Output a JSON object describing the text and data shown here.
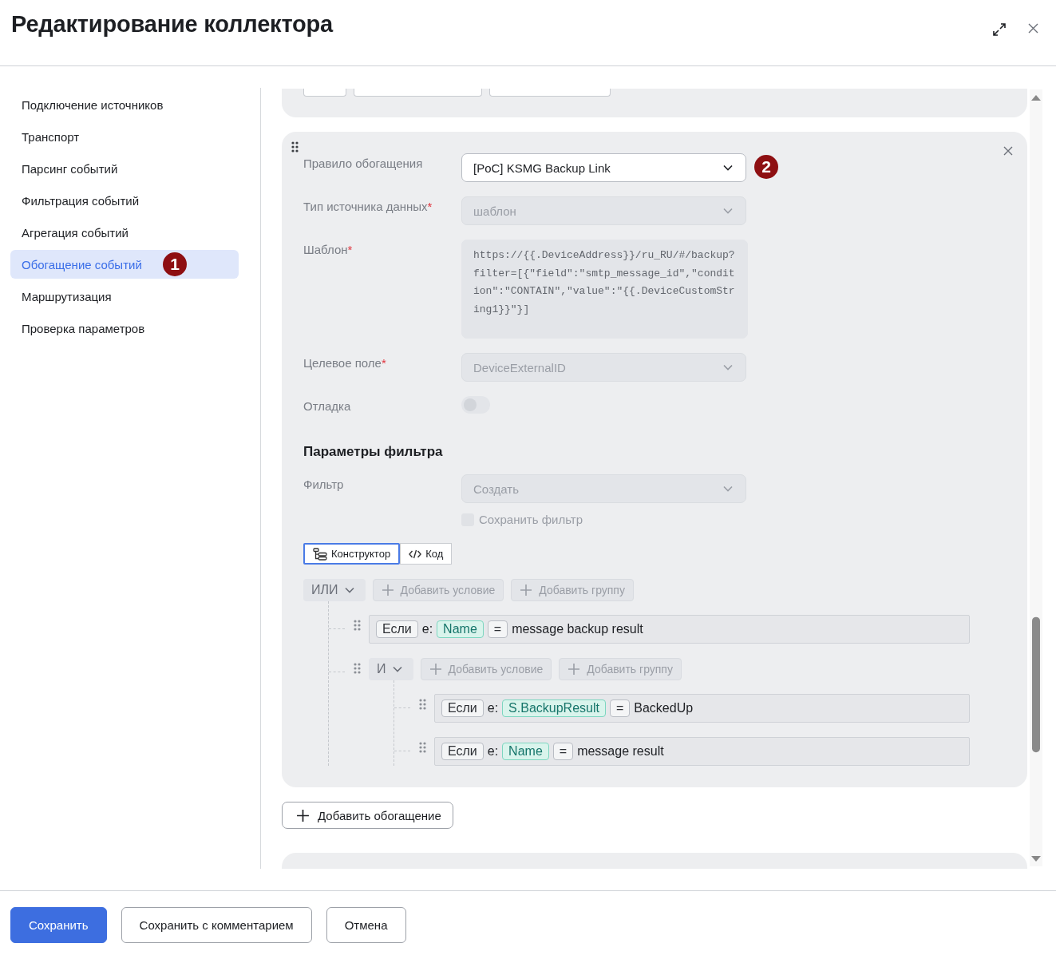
{
  "dialog": {
    "title": "Редактирование коллектора"
  },
  "sidebar": {
    "items": [
      {
        "label": "Подключение источников",
        "selected": false
      },
      {
        "label": "Транспорт",
        "selected": false
      },
      {
        "label": "Парсинг событий",
        "selected": false
      },
      {
        "label": "Фильтрация событий",
        "selected": false
      },
      {
        "label": "Агрегация событий",
        "selected": false
      },
      {
        "label": "Обогащение событий",
        "selected": true,
        "callout": "1"
      },
      {
        "label": "Маршрутизация",
        "selected": false
      },
      {
        "label": "Проверка параметров",
        "selected": false
      }
    ]
  },
  "enrichment": {
    "fields": [
      {
        "kind": "select",
        "label": "Правило обогащения",
        "value": "[PoC] KSMG Backup Link",
        "disabled": false,
        "callout": "2"
      },
      {
        "kind": "select",
        "label": "Тип источника данных",
        "required_mark": "*",
        "value": "шаблон",
        "disabled": true
      },
      {
        "kind": "textarea",
        "label": "Шаблон",
        "required_mark": "*",
        "value": "https://{{.DeviceAddress}}/ru_RU/#/backup?filter=[{\"field\":\"smtp_message_id\",\"condition\":\"CONTAIN\",\"value\":\"{{.DeviceCustomString1}}\"}]",
        "disabled": true
      },
      {
        "kind": "select",
        "label": "Целевое поле",
        "required_mark": "*",
        "value": "DeviceExternalID",
        "disabled": true
      },
      {
        "kind": "toggle",
        "label": "Отладка",
        "on": false,
        "disabled": true
      }
    ],
    "filter_section": {
      "title": "Параметры фильтра",
      "filter": {
        "label": "Фильтр",
        "value": "Создать",
        "disabled": true
      },
      "save_filter": {
        "label": "Сохранить фильтр",
        "checked": false,
        "disabled": true
      },
      "modes": [
        {
          "label": "Конструктор",
          "selected": true
        },
        {
          "label": "Код",
          "selected": false
        }
      ],
      "tree": {
        "operator": "ИЛИ",
        "add_condition": "Добавить условие",
        "add_group": "Добавить группу",
        "children": [
          {
            "kind": "condition",
            "keyword": "Если",
            "prefix": "e:",
            "field": "Name",
            "operator": "=",
            "value": "message backup result"
          },
          {
            "kind": "group",
            "operator": "И",
            "add_condition": "Добавить условие",
            "add_group": "Добавить группу",
            "children": [
              {
                "kind": "condition",
                "keyword": "Если",
                "prefix": "e:",
                "field": "S.BackupResult",
                "operator": "=",
                "value": "BackedUp"
              },
              {
                "kind": "condition",
                "keyword": "Если",
                "prefix": "e:",
                "field": "Name",
                "operator": "=",
                "value": "message result"
              }
            ]
          }
        ]
      }
    },
    "add_button": "Добавить обогащение"
  },
  "footer": {
    "buttons": [
      {
        "label": "Сохранить",
        "kind": "primary"
      },
      {
        "label": "Сохранить с комментарием",
        "kind": "secondary"
      },
      {
        "label": "Отмена",
        "kind": "secondary"
      }
    ]
  }
}
